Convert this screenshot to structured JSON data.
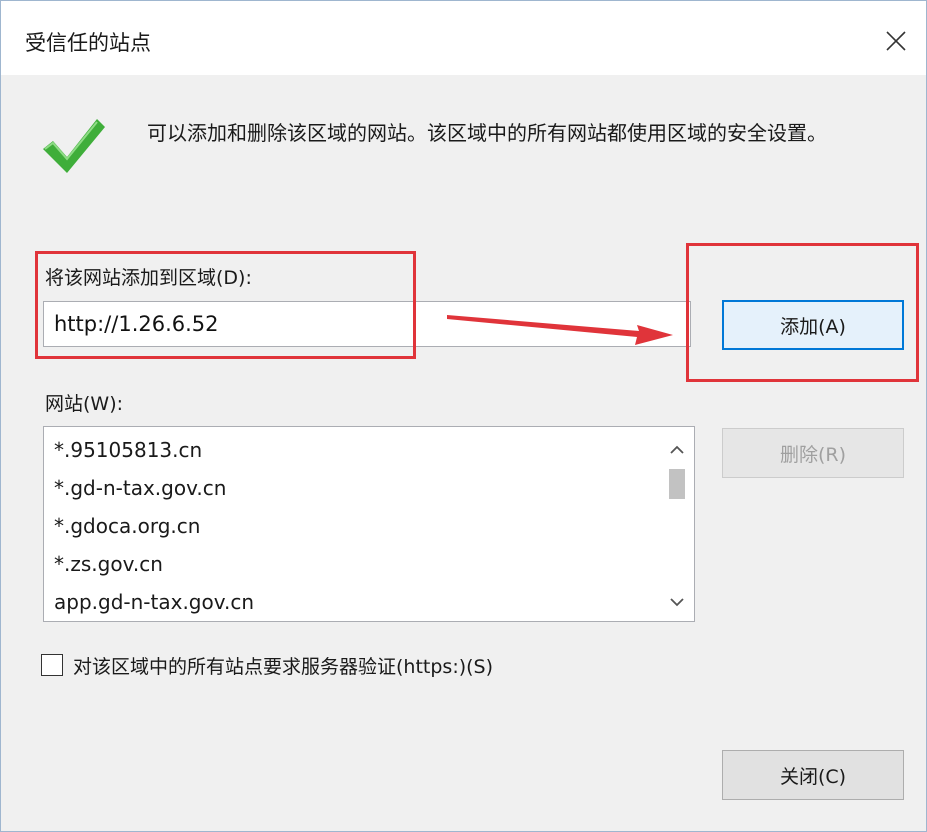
{
  "window": {
    "title": "受信任的站点"
  },
  "icons": {
    "check": "checkmark-icon",
    "close": "close-icon",
    "scroll_up": "chevron-up-icon",
    "scroll_down": "chevron-down-icon"
  },
  "description": "可以添加和删除该区域的网站。该区域中的所有网站都使用区域的安全设置。",
  "add_section": {
    "label": "将该网站添加到区域(D):",
    "input_value": "http://1.26.6.52",
    "add_button": "添加(A)"
  },
  "sites_section": {
    "label": "网站(W):",
    "items": [
      "*.95105813.cn",
      "*.gd-n-tax.gov.cn",
      "*.gdoca.org.cn",
      "*.zs.gov.cn",
      "app.gd-n-tax.gov.cn"
    ],
    "remove_button": "删除(R)"
  },
  "https_option": {
    "label": "对该区域中的所有站点要求服务器验证(https:)(S)",
    "checked": false
  },
  "footer": {
    "close_button": "关闭(C)"
  },
  "colors": {
    "annotation_red": "#e0343a",
    "accent_blue": "#0078d7",
    "check_green": "#3fae3a"
  }
}
